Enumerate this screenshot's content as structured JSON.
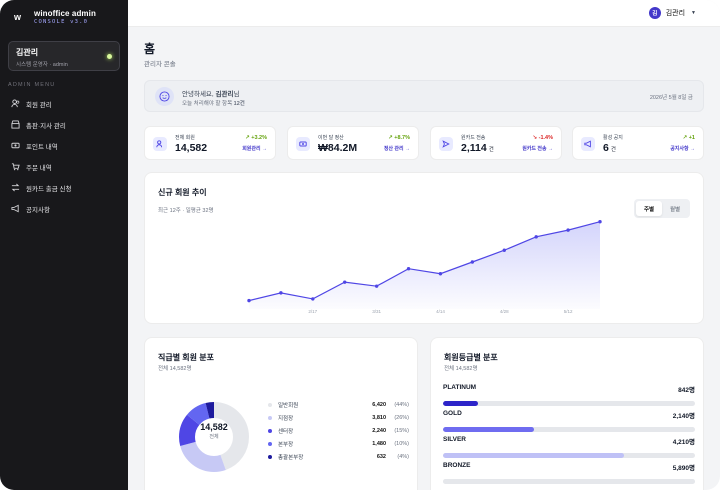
{
  "brand": {
    "mark": "w",
    "name": "winoffice admin",
    "sub": "CONSOLE v3.0"
  },
  "sidebar_user": {
    "name": "김관리",
    "role": "시스템 운영자 · admin"
  },
  "menu_title": "ADMIN MENU",
  "menu": [
    {
      "label": "회원 관리",
      "icon": "users-icon"
    },
    {
      "label": "총판·지사 관리",
      "icon": "store-icon"
    },
    {
      "label": "포인트 내역",
      "icon": "money-icon"
    },
    {
      "label": "주문 내역",
      "icon": "cart-icon"
    },
    {
      "label": "원카드 출금 신청",
      "icon": "transfer-icon"
    },
    {
      "label": "공지사항",
      "icon": "megaphone-icon"
    }
  ],
  "top_user": {
    "avatar": "김",
    "name": "김관리"
  },
  "page": {
    "title": "홈",
    "subtitle": "관리자 콘솔"
  },
  "welcome": {
    "greet": "안녕하세요, ",
    "name": "김관리",
    "suffix": "님",
    "todo_text": "오늘 처리해야 할 항목 ",
    "todo_count": "12건",
    "date": "2026년 5월 8일 금"
  },
  "stats": [
    {
      "label": "전체 회원",
      "value": "14,582",
      "unit": "",
      "delta": "+3.2%",
      "trend": "up",
      "link": "회원관리 →",
      "icon": "users-icon"
    },
    {
      "label": "이번 달 정산",
      "value": "₩84.2M",
      "unit": "",
      "delta": "+8.7%",
      "trend": "up",
      "link": "정산 관리 →",
      "icon": "money-icon"
    },
    {
      "label": "원카드 전송",
      "value": "2,114",
      "unit": "건",
      "delta": "-1.4%",
      "trend": "down",
      "link": "원카드 전송 →",
      "icon": "send-icon"
    },
    {
      "label": "활성 공지",
      "value": "6",
      "unit": "건",
      "delta": "+1",
      "trend": "up",
      "link": "공지사항 →",
      "icon": "megaphone-icon"
    }
  ],
  "trend_card": {
    "title": "신규 회원 추이",
    "subtitle": "최근 12주 · 일평균 32명",
    "toggle": [
      "주별",
      "월별"
    ],
    "active_toggle": "주별"
  },
  "chart_data": {
    "type": "area",
    "title": "신규 회원 추이",
    "x_ticks": [
      "2/17",
      "3/31",
      "4/14",
      "4/28",
      "5/12"
    ],
    "values": [
      195,
      218,
      200,
      250,
      238,
      290,
      275,
      310,
      345,
      385,
      405,
      430
    ],
    "ylim": [
      170,
      450
    ],
    "line_color": "#4f46e5",
    "grid": false
  },
  "rank_card": {
    "title": "직급별 회원 분포",
    "subtitle": "전체 14,582명",
    "center_value": "14,582",
    "center_label": "전체"
  },
  "rank_dist": [
    {
      "label": "일반회원",
      "value": "6,420",
      "pct": "(44%)",
      "share": 44,
      "color": "#e5e7eb"
    },
    {
      "label": "지점장",
      "value": "3,810",
      "pct": "(26%)",
      "share": 26,
      "color": "#c7c9f5"
    },
    {
      "label": "센터장",
      "value": "2,240",
      "pct": "(15%)",
      "share": 15,
      "color": "#4f46e5"
    },
    {
      "label": "본부장",
      "value": "1,480",
      "pct": "(10%)",
      "share": 10,
      "color": "#6366f1"
    },
    {
      "label": "총괄본부장",
      "value": "632",
      "pct": "(4%)",
      "share": 4,
      "color": "#1e1b9e"
    }
  ],
  "grade_card": {
    "title": "회원등급별 분포",
    "subtitle": "전체 14,582명"
  },
  "grades": [
    {
      "name": "PLATINUM",
      "value": "842명",
      "fill": 0.14,
      "color": "#2d24c9"
    },
    {
      "name": "GOLD",
      "value": "2,140명",
      "fill": 0.36,
      "color": "#6f6cf0"
    },
    {
      "name": "SILVER",
      "value": "4,210명",
      "fill": 0.72,
      "color": "#bfc1f6"
    },
    {
      "name": "BRONZE",
      "value": "5,890명",
      "fill": 1.0,
      "color": "#e5e7eb"
    }
  ]
}
